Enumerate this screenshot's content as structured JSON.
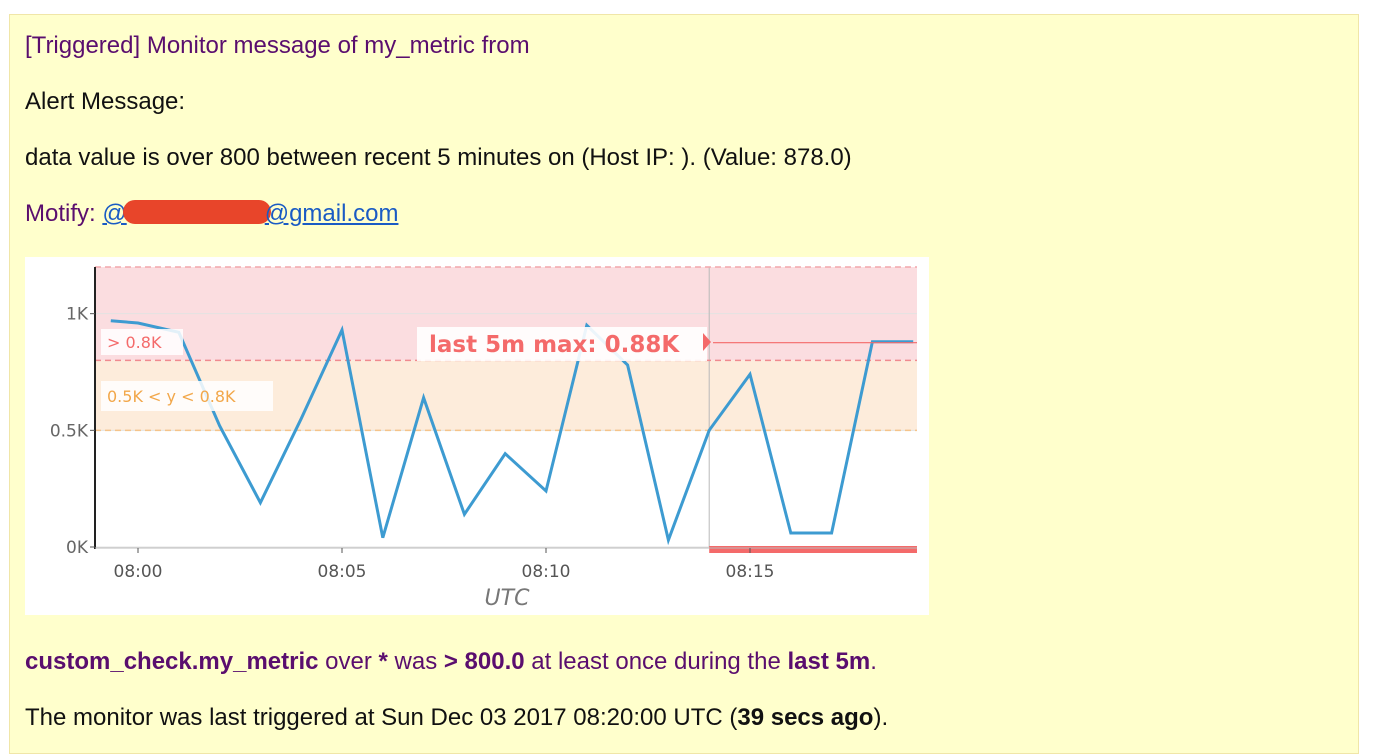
{
  "email": {
    "subject": "[Triggered] Monitor message of my_metric from",
    "alert_heading": "Alert Message:",
    "alert_body": "data value is over 800 between recent 5 minutes on (Host IP: ). (Value: 878.0)",
    "notify_label": "Motify: ",
    "notify_prefix": "@",
    "notify_suffix": "@gmail.com",
    "summary": {
      "metric": "custom_check.my_metric",
      "over": " over ",
      "scope": "*",
      "was": " was ",
      "condition": "> 800.0",
      "during": " at least once during the ",
      "window": "last 5m",
      "end": "."
    },
    "triggered": {
      "prefix": "The monitor was last triggered at Sun Dec 03 2017 08:20:00 UTC (",
      "ago": "39 secs ago",
      "suffix": ")."
    }
  },
  "colors": {
    "series_line": "#3d9bd1",
    "alert_zone": "#fbdde0",
    "warn_zone": "#fdecdb",
    "alert_marker": "#f46a6a",
    "warn_text": "#f2a74a",
    "email_bg": "#ffffcc",
    "purple_text": "#5a0e6e",
    "link": "#1a5bc4"
  },
  "chart_data": {
    "type": "line",
    "xlabel": "UTC",
    "ylabel": "",
    "x_ticks": [
      "08:00",
      "08:05",
      "08:10",
      "08:15"
    ],
    "y_ticks": [
      "0K",
      "0.5K",
      "1K"
    ],
    "ylim": [
      0,
      1.2
    ],
    "grid": true,
    "series": [
      {
        "x": [
          "07:59:20",
          "08:00",
          "08:01",
          "08:02",
          "08:03",
          "08:04",
          "08:05",
          "08:06",
          "08:07",
          "08:08",
          "08:09",
          "08:10",
          "08:11",
          "08:12",
          "08:13",
          "08:14",
          "08:15",
          "08:16",
          "08:17",
          "08:18",
          "08:19"
        ],
        "values": [
          0.97,
          0.96,
          0.92,
          0.52,
          0.19,
          0.55,
          0.93,
          0.04,
          0.64,
          0.14,
          0.4,
          0.24,
          0.95,
          0.78,
          0.03,
          0.5,
          0.74,
          0.06,
          0.06,
          0.88,
          0.88
        ]
      }
    ],
    "thresholds": {
      "alert_label": "> 0.8K",
      "warn_label": "0.5K < y < 0.8K"
    },
    "annotation": "last 5m max: 0.88K"
  }
}
